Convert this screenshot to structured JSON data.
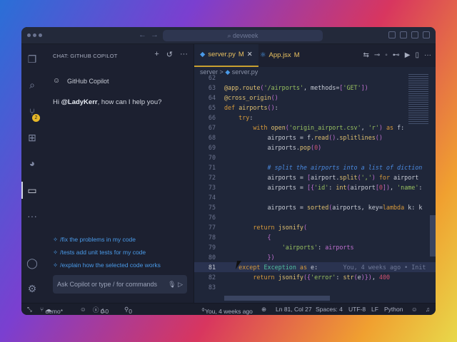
{
  "titlebar": {
    "search": "devweek"
  },
  "chat": {
    "header": "CHAT: GITHUB COPILOT",
    "assistant": "GitHub Copilot",
    "greeting_pre": "Hi ",
    "greeting_user": "@LadyKerr",
    "greeting_post": ", how can I help you?",
    "suggestions": [
      "/fix the problems in my code",
      "/tests add unit tests for my code",
      "/explain how the selected code works"
    ],
    "input_placeholder": "Ask Copilot or type / for commands"
  },
  "activity": {
    "scm_badge": "2"
  },
  "tabs": [
    {
      "label": "server.py",
      "status": "M"
    },
    {
      "label": "App.jsx",
      "status": "M"
    }
  ],
  "breadcrumb": [
    "server",
    ">",
    "server.py"
  ],
  "blame": "You, 4 weeks ago • Init",
  "status": {
    "branch": "demo*",
    "errors": "0",
    "warnings": "0",
    "ports": "0",
    "blame": "You, 4 weeks ago",
    "position": "Ln 81, Col 27",
    "spaces": "Spaces: 4",
    "encoding": "UTF-8",
    "eol": "LF",
    "language": "Python"
  }
}
